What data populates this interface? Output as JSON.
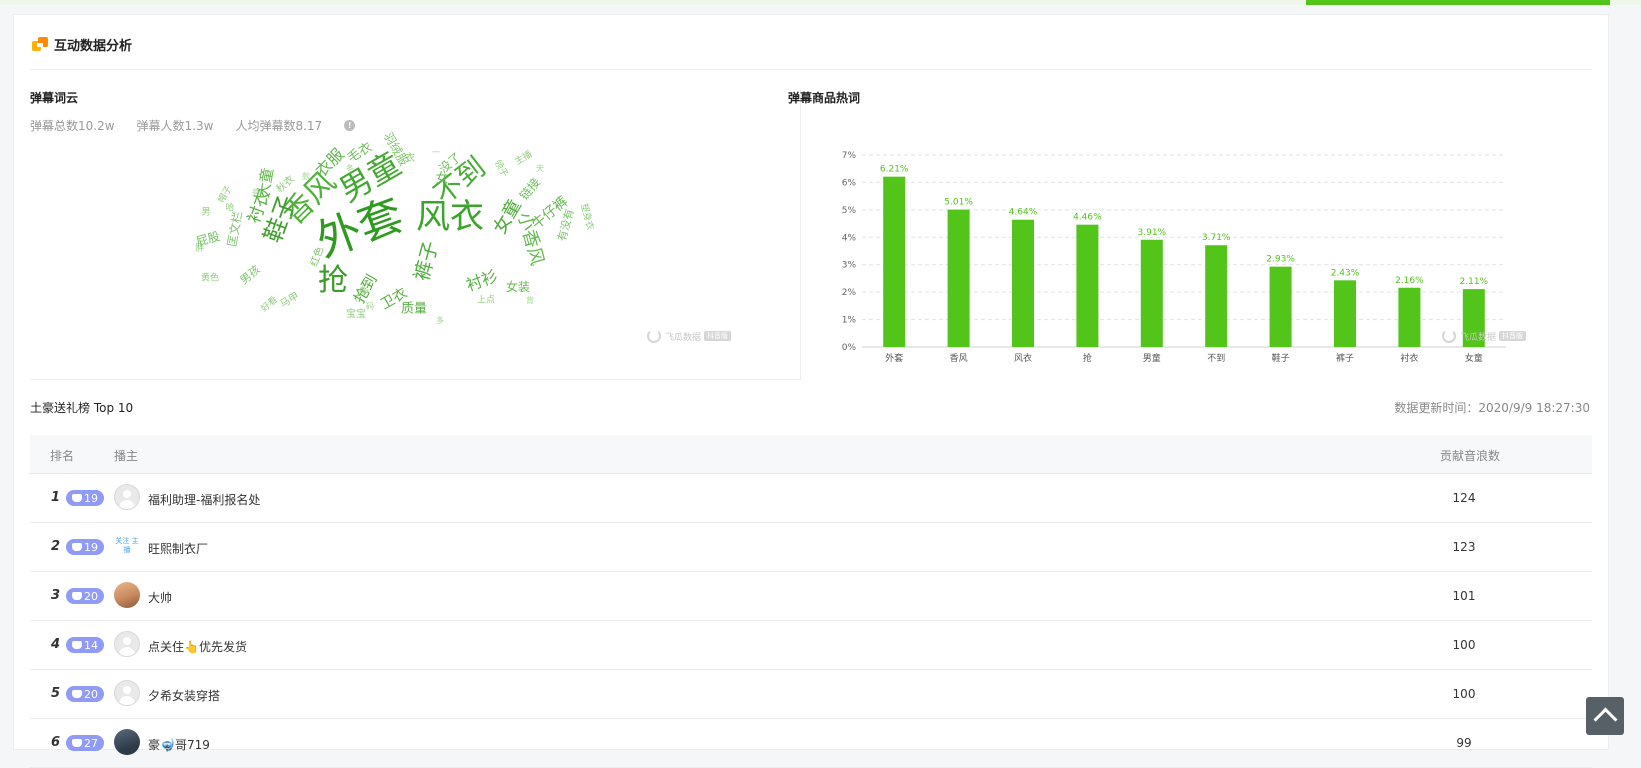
{
  "section": {
    "title": "互动数据分析"
  },
  "word_cloud": {
    "title": "弹幕词云",
    "stats": [
      "弹幕总数10.2w",
      "弹幕人数1.3w",
      "人均弹幕数8.17"
    ],
    "info_glyph": "!",
    "words": [
      {
        "text": "外套",
        "size": 44,
        "color": "#2e9a1f",
        "rot": -20
      },
      {
        "text": "风衣",
        "size": 34,
        "color": "#3aa52a",
        "rot": 0
      },
      {
        "text": "男童",
        "size": 32,
        "color": "#43a832",
        "rot": -30
      },
      {
        "text": "不到",
        "size": 28,
        "color": "#47ac34",
        "rot": -38
      },
      {
        "text": "香风",
        "size": 30,
        "color": "#4fb03b",
        "rot": -45
      },
      {
        "text": "鞋子",
        "size": 24,
        "color": "#3f9f2d",
        "rot": -70
      },
      {
        "text": "裤子",
        "size": 20,
        "color": "#52b03e",
        "rot": -75
      },
      {
        "text": "女童",
        "size": 18,
        "color": "#4aa834",
        "rot": -60
      },
      {
        "text": "小香风",
        "size": 18,
        "color": "#62b94d",
        "rot": 75
      },
      {
        "text": "抢",
        "size": 30,
        "color": "#3b9c29",
        "rot": 0
      },
      {
        "text": "衬衫",
        "size": 16,
        "color": "#55b040",
        "rot": -20
      },
      {
        "text": "衣服",
        "size": 16,
        "color": "#5fb64a",
        "rot": -45
      },
      {
        "text": "衬衣",
        "size": 17,
        "color": "#55b040",
        "rot": -70
      },
      {
        "text": "大童",
        "size": 15,
        "color": "#5fb64a",
        "rot": -80
      },
      {
        "text": "牛仔裤",
        "size": 14,
        "color": "#63b950",
        "rot": -40
      },
      {
        "text": "女装",
        "size": 12,
        "color": "#63b950",
        "rot": 0
      },
      {
        "text": "卫衣",
        "size": 14,
        "color": "#5aaf45",
        "rot": -30
      },
      {
        "text": "质量",
        "size": 13,
        "color": "#5aaf45",
        "rot": 0
      },
      {
        "text": "抢到",
        "size": 15,
        "color": "#4ea93a",
        "rot": -60
      },
      {
        "text": "毛衣",
        "size": 13,
        "color": "#6fbf5c",
        "rot": -30
      },
      {
        "text": "羽绒服",
        "size": 12,
        "color": "#7ec66c",
        "rot": 60
      },
      {
        "text": "没了",
        "size": 12,
        "color": "#6fbf5c",
        "rot": -40
      },
      {
        "text": "女",
        "size": 13,
        "color": "#63b950",
        "rot": 0
      },
      {
        "text": "链接",
        "size": 12,
        "color": "#6fbf5c",
        "rot": -50
      },
      {
        "text": "有没有",
        "size": 11,
        "color": "#7ec66c",
        "rot": -75
      },
      {
        "text": "塑身衣",
        "size": 9,
        "color": "#8fce7e",
        "rot": 75
      },
      {
        "text": "匡文栏",
        "size": 12,
        "color": "#7ec66c",
        "rot": -80
      },
      {
        "text": "屁股",
        "size": 12,
        "color": "#6fbf5c",
        "rot": -15
      },
      {
        "text": "男孩",
        "size": 11,
        "color": "#7ec66c",
        "rot": -40
      },
      {
        "text": "红色",
        "size": 10,
        "color": "#7ec66c",
        "rot": -70
      },
      {
        "text": "马甲",
        "size": 10,
        "color": "#8fce7e",
        "rot": -30
      },
      {
        "text": "宝宝",
        "size": 10,
        "color": "#8fce7e",
        "rot": 0
      },
      {
        "text": "黄色",
        "size": 9,
        "color": "#8fce7e",
        "rot": 0
      },
      {
        "text": "秋衣",
        "size": 10,
        "color": "#8fce7e",
        "rot": -40
      },
      {
        "text": "上点",
        "size": 9,
        "color": "#8fce7e",
        "rot": 0
      },
      {
        "text": "领子",
        "size": 9,
        "color": "#8fce7e",
        "rot": 60
      },
      {
        "text": "主播",
        "size": 9,
        "color": "#8fce7e",
        "rot": -30
      },
      {
        "text": "帽子",
        "size": 9,
        "color": "#8fce7e",
        "rot": -60
      },
      {
        "text": "小童",
        "size": 9,
        "color": "#8fce7e",
        "rot": -50
      },
      {
        "text": "好看",
        "size": 9,
        "color": "#8fce7e",
        "rot": -40
      },
      {
        "text": "衣",
        "size": 10,
        "color": "#8fce7e",
        "rot": 0
      },
      {
        "text": "哈",
        "size": 9,
        "color": "#8fce7e",
        "rot": 0
      },
      {
        "text": "男",
        "size": 9,
        "color": "#8fce7e",
        "rot": 0
      },
      {
        "text": "胖",
        "size": 9,
        "color": "#8fce7e",
        "rot": 0
      },
      {
        "text": "背",
        "size": 8,
        "color": "#9ad68a",
        "rot": 0
      },
      {
        "text": "一",
        "size": 8,
        "color": "#9ad68a",
        "rot": 0
      },
      {
        "text": "款",
        "size": 8,
        "color": "#9ad68a",
        "rot": 0
      },
      {
        "text": "码",
        "size": 8,
        "color": "#9ad68a",
        "rot": 0
      },
      {
        "text": "亮",
        "size": 8,
        "color": "#9ad68a",
        "rot": 0
      },
      {
        "text": "天",
        "size": 8,
        "color": "#9ad68a",
        "rot": 0
      },
      {
        "text": "冬",
        "size": 8,
        "color": "#9ad68a",
        "rot": 0
      },
      {
        "text": "多",
        "size": 8,
        "color": "#9ad68a",
        "rot": 0
      }
    ]
  },
  "watermark": {
    "name": "飞瓜数据",
    "tag": "抖音版"
  },
  "bar_chart": {
    "title": "弹幕商品热词"
  },
  "chart_data": {
    "type": "bar",
    "categories": [
      "外套",
      "香风",
      "风衣",
      "抢",
      "男童",
      "不到",
      "鞋子",
      "裤子",
      "衬衣",
      "女童"
    ],
    "values": [
      6.21,
      5.01,
      4.64,
      4.46,
      3.91,
      3.71,
      2.93,
      2.43,
      2.16,
      2.11
    ],
    "value_labels": [
      "6.21%",
      "5.01%",
      "4.64%",
      "4.46%",
      "3.91%",
      "3.71%",
      "2.93%",
      "2.43%",
      "2.16%",
      "2.11%"
    ],
    "yticks": [
      "0%",
      "1%",
      "2%",
      "3%",
      "4%",
      "5%",
      "6%",
      "7%"
    ],
    "ylim": [
      0,
      7
    ],
    "bar_color": "#52c41a",
    "grid": true
  },
  "ranking": {
    "title": "土豪送礼榜 Top 10",
    "update_time": "数据更新时间：2020/9/9 18:27:30",
    "headers": {
      "rank": "排名",
      "anchor": "播主",
      "contribution": "贡献音浪数"
    },
    "rows": [
      {
        "rank": "1",
        "level": "19",
        "name": "福利助理-福利报名处",
        "value": "124",
        "avatar": "default",
        "avatar_text": ""
      },
      {
        "rank": "2",
        "level": "19",
        "name": "旺熙制衣厂",
        "value": "123",
        "avatar": "tag",
        "avatar_text": "关注 主播"
      },
      {
        "rank": "3",
        "level": "20",
        "name": "大帅",
        "value": "101",
        "avatar": "photo",
        "avatar_text": ""
      },
      {
        "rank": "4",
        "level": "14",
        "name": "点关住👆优先发货",
        "value": "100",
        "avatar": "default",
        "avatar_text": ""
      },
      {
        "rank": "5",
        "level": "20",
        "name": "夕希女装穿搭",
        "value": "100",
        "avatar": "default",
        "avatar_text": ""
      },
      {
        "rank": "6",
        "level": "27",
        "name": "豪🤿哥719",
        "value": "99",
        "avatar": "dark",
        "avatar_text": ""
      }
    ]
  }
}
